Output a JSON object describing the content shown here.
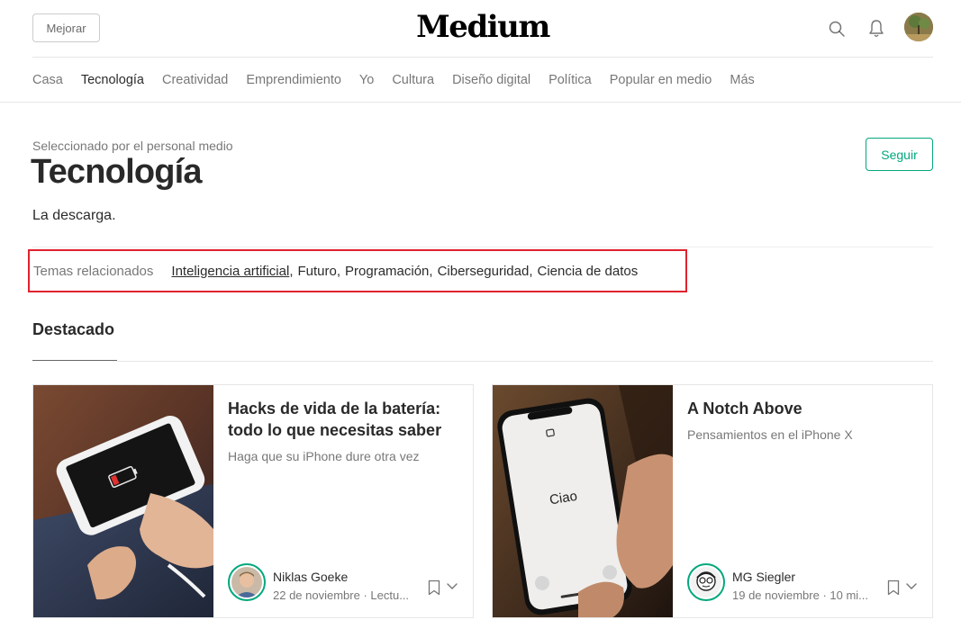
{
  "header": {
    "upgrade_label": "Mejorar",
    "logo": "Medium",
    "icons": {
      "search": "search-icon",
      "notifications": "bell-icon",
      "avatar": "user-avatar"
    }
  },
  "nav": {
    "items": [
      "Casa",
      "Tecnología",
      "Creatividad",
      "Emprendimiento",
      "Yo",
      "Cultura",
      "Diseño digital",
      "Política",
      "Popular en medio",
      "Más"
    ],
    "active": "Tecnología"
  },
  "topic_page": {
    "curated_by": "Seleccionado por el personal medio",
    "title": "Tecnología",
    "tagline": "La descarga.",
    "follow_label": "Seguir"
  },
  "related_topics": {
    "label": "Temas relacionados",
    "topics": [
      "Inteligencia artificial",
      "Futuro",
      "Programación",
      "Ciberseguridad",
      "Ciencia de datos"
    ]
  },
  "featured": {
    "heading": "Destacado",
    "cards": [
      {
        "title": "Hacks de vida de la batería: todo lo que necesitas saber",
        "subtitle": "Haga que su iPhone dure otra vez",
        "author": "Niklas Goeke",
        "meta": "22 de noviembre · Lectu..."
      },
      {
        "title": "A Notch Above",
        "subtitle": "Pensamientos en el iPhone X",
        "author": "MG Siegler",
        "meta": "19 de noviembre · 10 mi...",
        "image_text": "Ciao"
      }
    ]
  },
  "colors": {
    "accent_green": "#03a87c",
    "highlight_red": "#e0222e",
    "text_primary": "rgba(0,0,0,0.84)",
    "text_secondary": "rgba(0,0,0,0.54)"
  }
}
